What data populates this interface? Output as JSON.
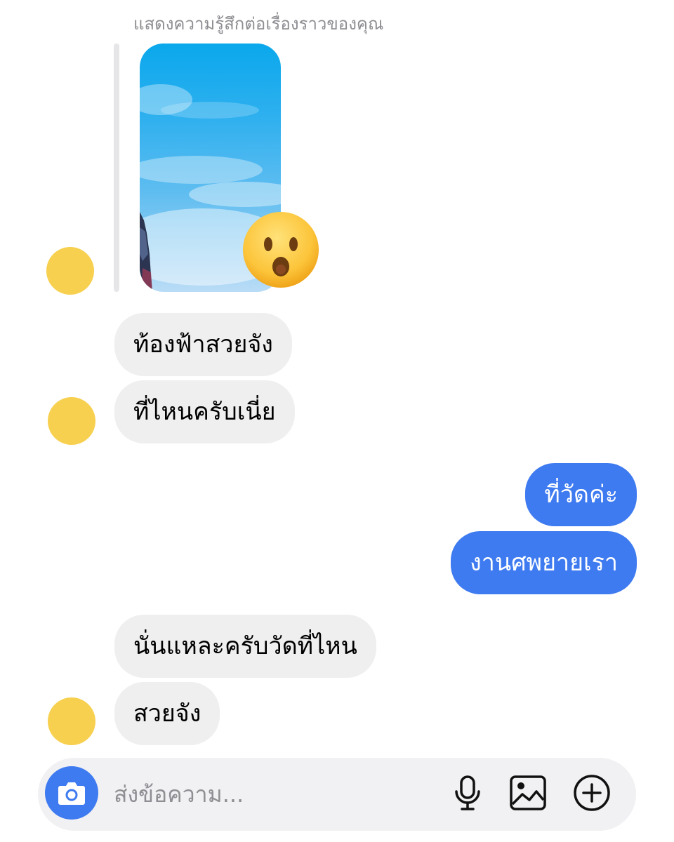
{
  "story_reply": {
    "caption": "แสดงความรู้สึกต่อเรื่องราวของคุณ",
    "reaction": "surprised-face-emoji"
  },
  "messages": [
    {
      "sender": "other",
      "text": "ท้องฟ้าสวยจัง"
    },
    {
      "sender": "other",
      "text": "ที่ไหนครับเนี่ย"
    },
    {
      "sender": "me",
      "text": "ที่วัดค่ะ"
    },
    {
      "sender": "me",
      "text": "งานศพยายเรา"
    },
    {
      "sender": "other",
      "text": "นั่นแหละครับวัดที่ไหน"
    },
    {
      "sender": "other",
      "text": "สวยจัง"
    }
  ],
  "composer": {
    "placeholder": "ส่งข้อความ...",
    "value": "",
    "icons": [
      "camera-icon",
      "microphone-icon",
      "image-icon",
      "add-icon"
    ]
  },
  "colors": {
    "outgoing_bubble": "#3e7af0",
    "incoming_bubble": "#efefef",
    "avatar": "#f7d04f",
    "caption_text": "#8e8e93",
    "composer_background": "#f1f1f3"
  }
}
